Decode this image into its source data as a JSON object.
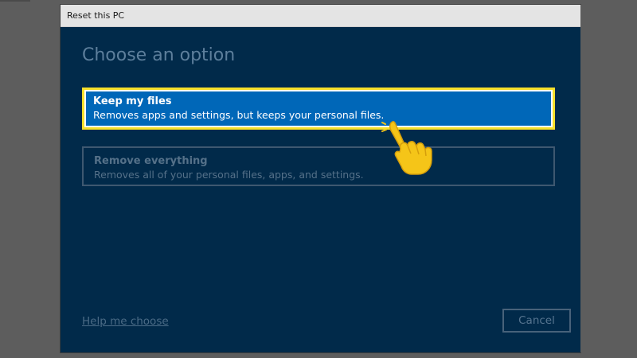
{
  "window": {
    "title": "Reset this PC"
  },
  "main": {
    "heading": "Choose an option",
    "options": [
      {
        "title": "Keep my files",
        "description": "Removes apps and settings, but keeps your personal files."
      },
      {
        "title": "Remove everything",
        "description": "Removes all of your personal files, apps, and settings."
      }
    ],
    "help_link": "Help me choose",
    "cancel_label": "Cancel"
  },
  "colors": {
    "window_bg": "#012a4a",
    "selected_option_bg": "#0067b8",
    "highlight_border": "#f7e02b",
    "pointer_hand": "#f5c518"
  },
  "icons": {
    "pointer": "pointing-hand-icon"
  }
}
